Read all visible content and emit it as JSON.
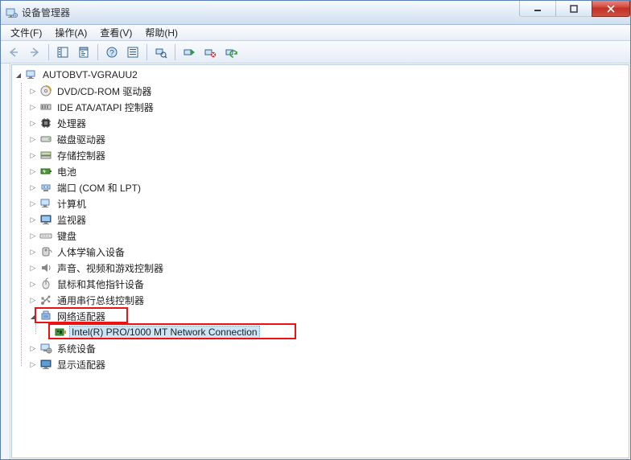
{
  "window": {
    "title": "设备管理器"
  },
  "menubar": {
    "file": "文件(F)",
    "action": "操作(A)",
    "view": "查看(V)",
    "help": "帮助(H)"
  },
  "tree": {
    "root": "AUTOBVT-VGRAUU2",
    "items": [
      {
        "label": "DVD/CD-ROM 驱动器",
        "icon": "disc"
      },
      {
        "label": "IDE ATA/ATAPI 控制器",
        "icon": "ide"
      },
      {
        "label": "处理器",
        "icon": "cpu"
      },
      {
        "label": "磁盘驱动器",
        "icon": "hdd"
      },
      {
        "label": "存储控制器",
        "icon": "storage"
      },
      {
        "label": "电池",
        "icon": "battery"
      },
      {
        "label": "端口 (COM 和 LPT)",
        "icon": "port"
      },
      {
        "label": "计算机",
        "icon": "computer"
      },
      {
        "label": "监视器",
        "icon": "monitor"
      },
      {
        "label": "键盘",
        "icon": "keyboard"
      },
      {
        "label": "人体学输入设备",
        "icon": "hid"
      },
      {
        "label": "声音、视频和游戏控制器",
        "icon": "sound"
      },
      {
        "label": "鼠标和其他指针设备",
        "icon": "mouse"
      },
      {
        "label": "通用串行总线控制器",
        "icon": "usb"
      }
    ],
    "network_adapters": {
      "label": "网络适配器",
      "child": "Intel(R) PRO/1000 MT Network Connection"
    },
    "tail": [
      {
        "label": "系统设备",
        "icon": "system"
      },
      {
        "label": "显示适配器",
        "icon": "display"
      }
    ]
  }
}
